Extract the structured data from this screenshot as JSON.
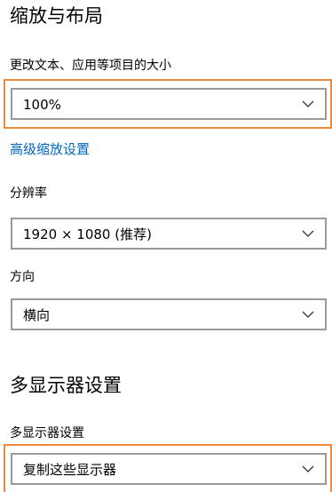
{
  "scale_layout": {
    "title": "缩放与布局",
    "text_size_label": "更改文本、应用等项目的大小",
    "text_size_value": "100%",
    "advanced_link": "高级缩放设置",
    "resolution_label": "分辨率",
    "resolution_value": "1920 × 1080 (推荐)",
    "orientation_label": "方向",
    "orientation_value": "横向"
  },
  "multi_display": {
    "title": "多显示器设置",
    "label": "多显示器设置",
    "value": "复制这些显示器"
  },
  "colors": {
    "accent_link": "#0067c0",
    "highlight": "#f0883a",
    "select_border": "#999999"
  },
  "icons": {
    "dropdown": "chevron-down-icon"
  }
}
